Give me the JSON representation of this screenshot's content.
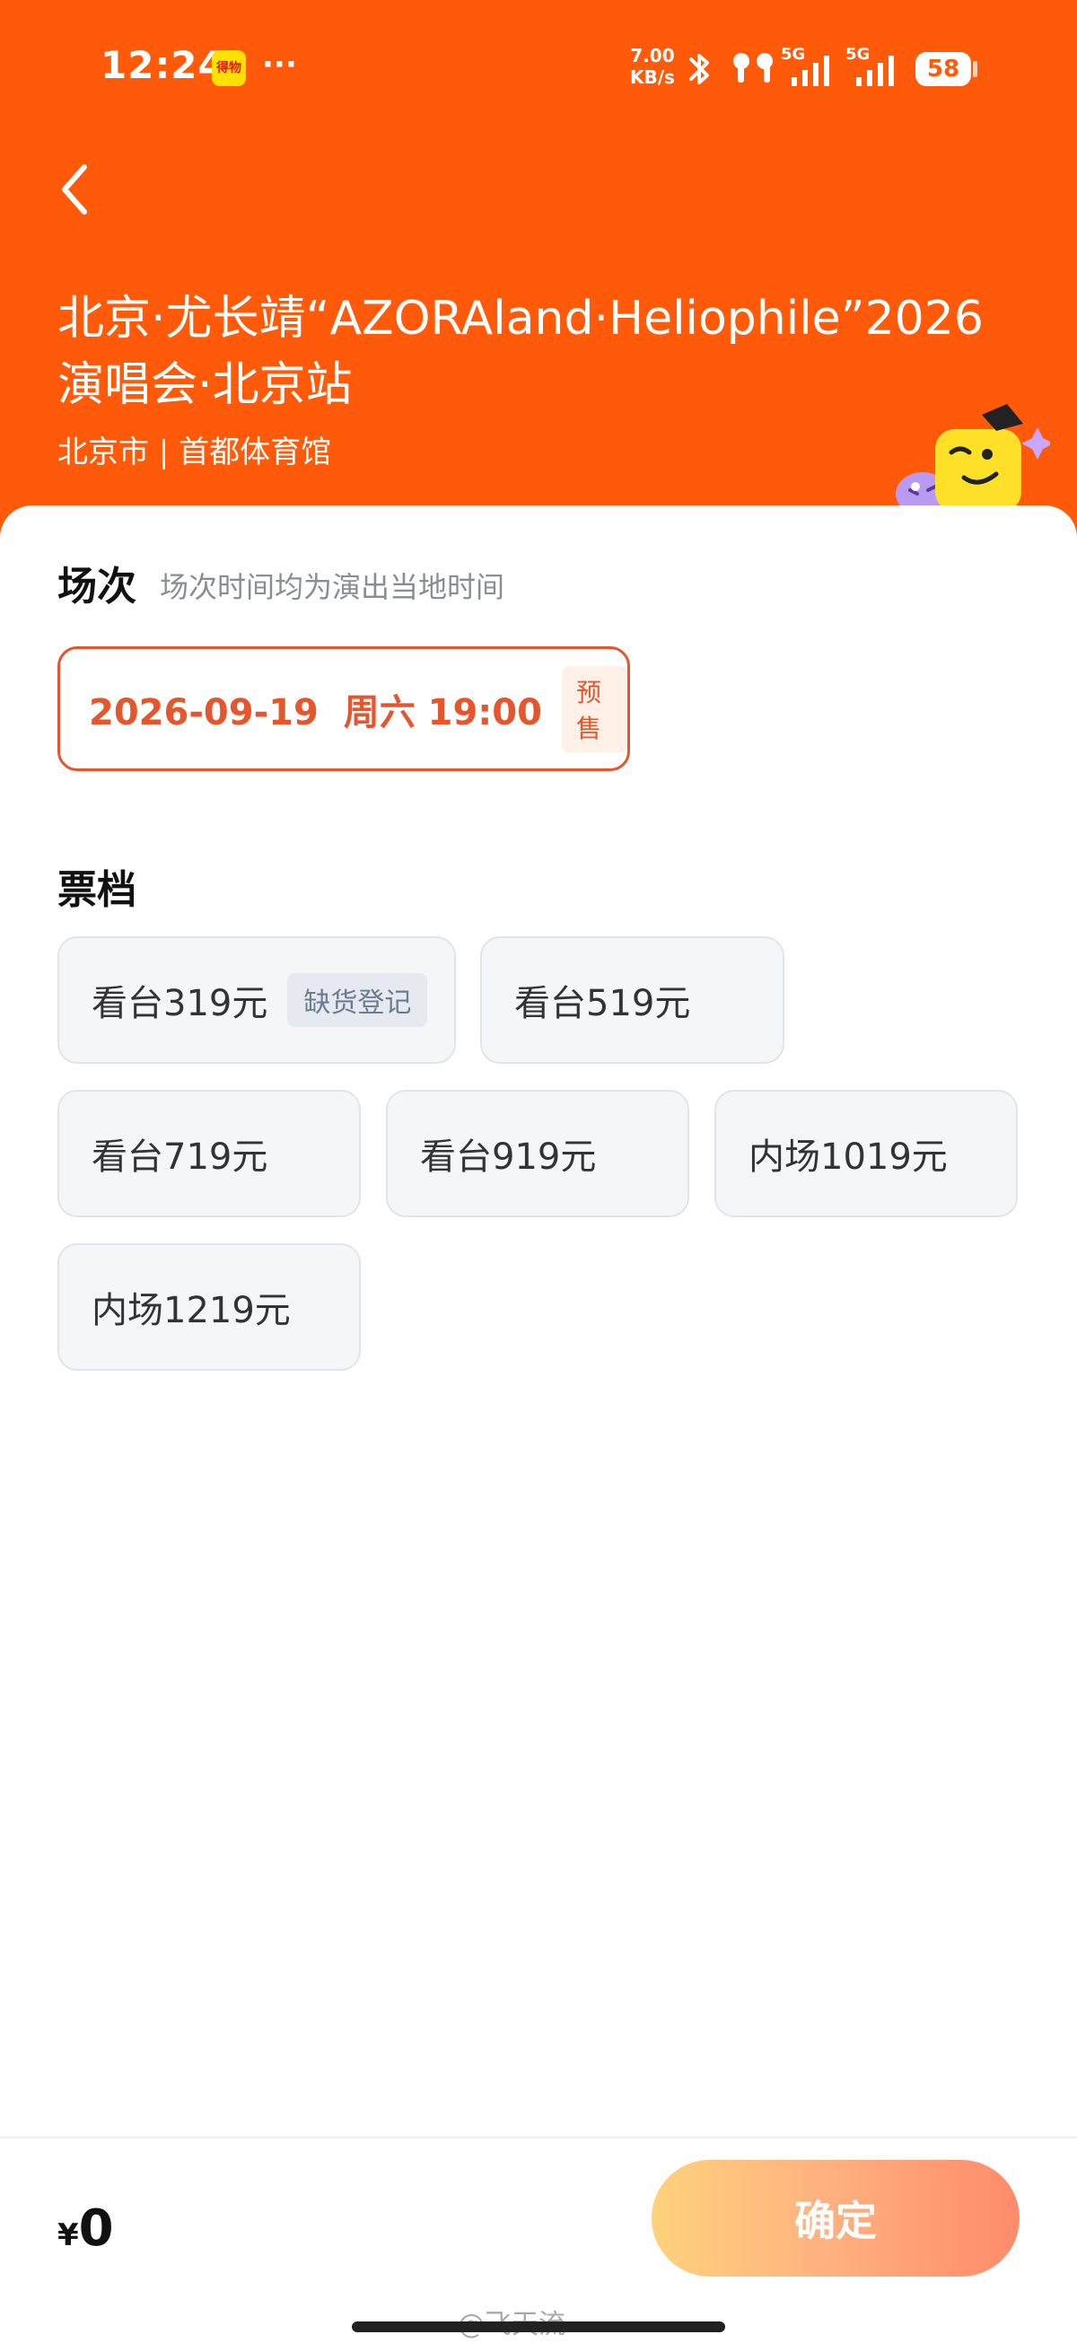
{
  "status_bar": {
    "time": "12:24",
    "app_badge": "得物",
    "more_dots": "···",
    "net_speed_value": "7.00",
    "net_speed_unit": "KB/s",
    "signal1_label": "5G",
    "signal2_label": "5G",
    "battery": "58"
  },
  "header": {
    "title": "北京·尤长靖“AZORAland·Heliophile”2026演唱会·北京站",
    "venue": "北京市 | 首都体育馆"
  },
  "session_section": {
    "title": "场次",
    "hint": "场次时间均为演出当地时间",
    "options": [
      {
        "date": "2026-09-19  周六 19:00",
        "tag": "预售",
        "selected": true
      }
    ]
  },
  "tier_section": {
    "title": "票档",
    "tiers": [
      {
        "label": "看台319元",
        "tag": "缺货登记"
      },
      {
        "label": "看台519元"
      },
      {
        "label": "看台719元"
      },
      {
        "label": "看台919元"
      },
      {
        "label": "内场1019元"
      },
      {
        "label": "内场1219元"
      }
    ]
  },
  "bottom_bar": {
    "currency": "¥",
    "amount": "0",
    "confirm_label": "确定",
    "watermark": "@飞天流"
  },
  "colors": {
    "brand": "#FE5A0A",
    "accent": "#E5562D",
    "tier_bg": "#F5F6F8"
  }
}
